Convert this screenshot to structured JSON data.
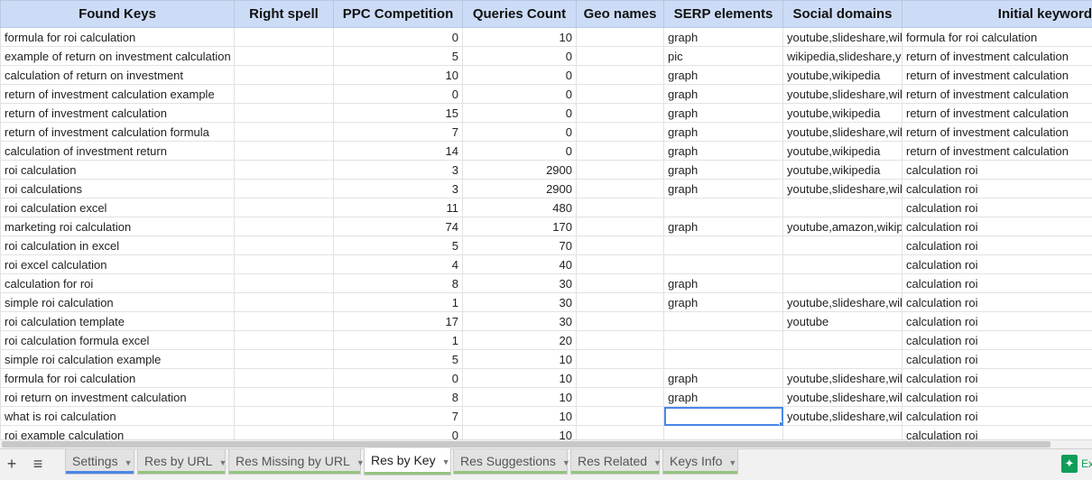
{
  "headers": [
    "Found Keys",
    "Right spell",
    "PPC Competition",
    "Queries Count",
    "Geo names",
    "SERP elements",
    "Social domains",
    "Initial keyword"
  ],
  "rows": [
    [
      "formula for roi calculation",
      "",
      "0",
      "10",
      "",
      "graph",
      "youtube,slideshare,wikipedia",
      "formula for roi calculation"
    ],
    [
      "example of return on investment calculation",
      "",
      "5",
      "0",
      "",
      "pic",
      "wikipedia,slideshare,youtube",
      "return of investment calculation"
    ],
    [
      "calculation of return on investment",
      "",
      "10",
      "0",
      "",
      "graph",
      "youtube,wikipedia",
      "return of investment calculation"
    ],
    [
      "return of investment calculation example",
      "",
      "0",
      "0",
      "",
      "graph",
      "youtube,slideshare,wikipedia",
      "return of investment calculation"
    ],
    [
      "return of investment calculation",
      "",
      "15",
      "0",
      "",
      "graph",
      "youtube,wikipedia",
      "return of investment calculation"
    ],
    [
      "return of investment calculation formula",
      "",
      "7",
      "0",
      "",
      "graph",
      "youtube,slideshare,wikipedia",
      "return of investment calculation"
    ],
    [
      "calculation of investment return",
      "",
      "14",
      "0",
      "",
      "graph",
      "youtube,wikipedia",
      "return of investment calculation"
    ],
    [
      "roi calculation",
      "",
      "3",
      "2900",
      "",
      "graph",
      "youtube,wikipedia",
      "calculation roi"
    ],
    [
      "roi calculations",
      "",
      "3",
      "2900",
      "",
      "graph",
      "youtube,slideshare,wikipedia",
      "calculation roi"
    ],
    [
      "roi calculation excel",
      "",
      "11",
      "480",
      "",
      "",
      "",
      "calculation roi"
    ],
    [
      "marketing roi calculation",
      "",
      "74",
      "170",
      "",
      "graph",
      "youtube,amazon,wikipedia",
      "calculation roi"
    ],
    [
      "roi calculation in excel",
      "",
      "5",
      "70",
      "",
      "",
      "",
      "calculation roi"
    ],
    [
      "roi excel calculation",
      "",
      "4",
      "40",
      "",
      "",
      "",
      "calculation roi"
    ],
    [
      "calculation for roi",
      "",
      "8",
      "30",
      "",
      "graph",
      "",
      "calculation roi"
    ],
    [
      "simple roi calculation",
      "",
      "1",
      "30",
      "",
      "graph",
      "youtube,slideshare,wikipedia",
      "calculation roi"
    ],
    [
      "roi calculation template",
      "",
      "17",
      "30",
      "",
      "",
      "youtube",
      "calculation roi"
    ],
    [
      "roi calculation formula excel",
      "",
      "1",
      "20",
      "",
      "",
      "",
      "calculation roi"
    ],
    [
      "simple roi calculation example",
      "",
      "5",
      "10",
      "",
      "",
      "",
      "calculation roi"
    ],
    [
      "formula for roi calculation",
      "",
      "0",
      "10",
      "",
      "graph",
      "youtube,slideshare,wikipedia",
      "calculation roi"
    ],
    [
      "roi return on investment calculation",
      "",
      "8",
      "10",
      "",
      "graph",
      "youtube,slideshare,wikipedia",
      "calculation roi"
    ],
    [
      "what is roi calculation",
      "",
      "7",
      "10",
      "",
      "",
      "youtube,slideshare,wikipedia",
      "calculation roi"
    ],
    [
      "roi example calculation",
      "",
      "0",
      "10",
      "",
      "",
      "",
      "calculation roi"
    ]
  ],
  "selected": {
    "row": 20,
    "col": 5
  },
  "tabs": [
    {
      "label": "Settings",
      "stripe": "#4a86e8"
    },
    {
      "label": "Res by URL",
      "stripe": "#93c47d"
    },
    {
      "label": "Res Missing by URL",
      "stripe": "#93c47d"
    },
    {
      "label": "Res by Key",
      "stripe": "#93c47d",
      "active": true
    },
    {
      "label": "Res Suggestions",
      "stripe": "#93c47d"
    },
    {
      "label": "Res Related",
      "stripe": "#93c47d"
    },
    {
      "label": "Keys Info",
      "stripe": "#93c47d"
    }
  ],
  "controls": {
    "add_sheet": "+",
    "all_sheets": "≡"
  },
  "explore": {
    "label": "Explore",
    "icon": "explore-icon",
    "color": "#0f9d58"
  }
}
